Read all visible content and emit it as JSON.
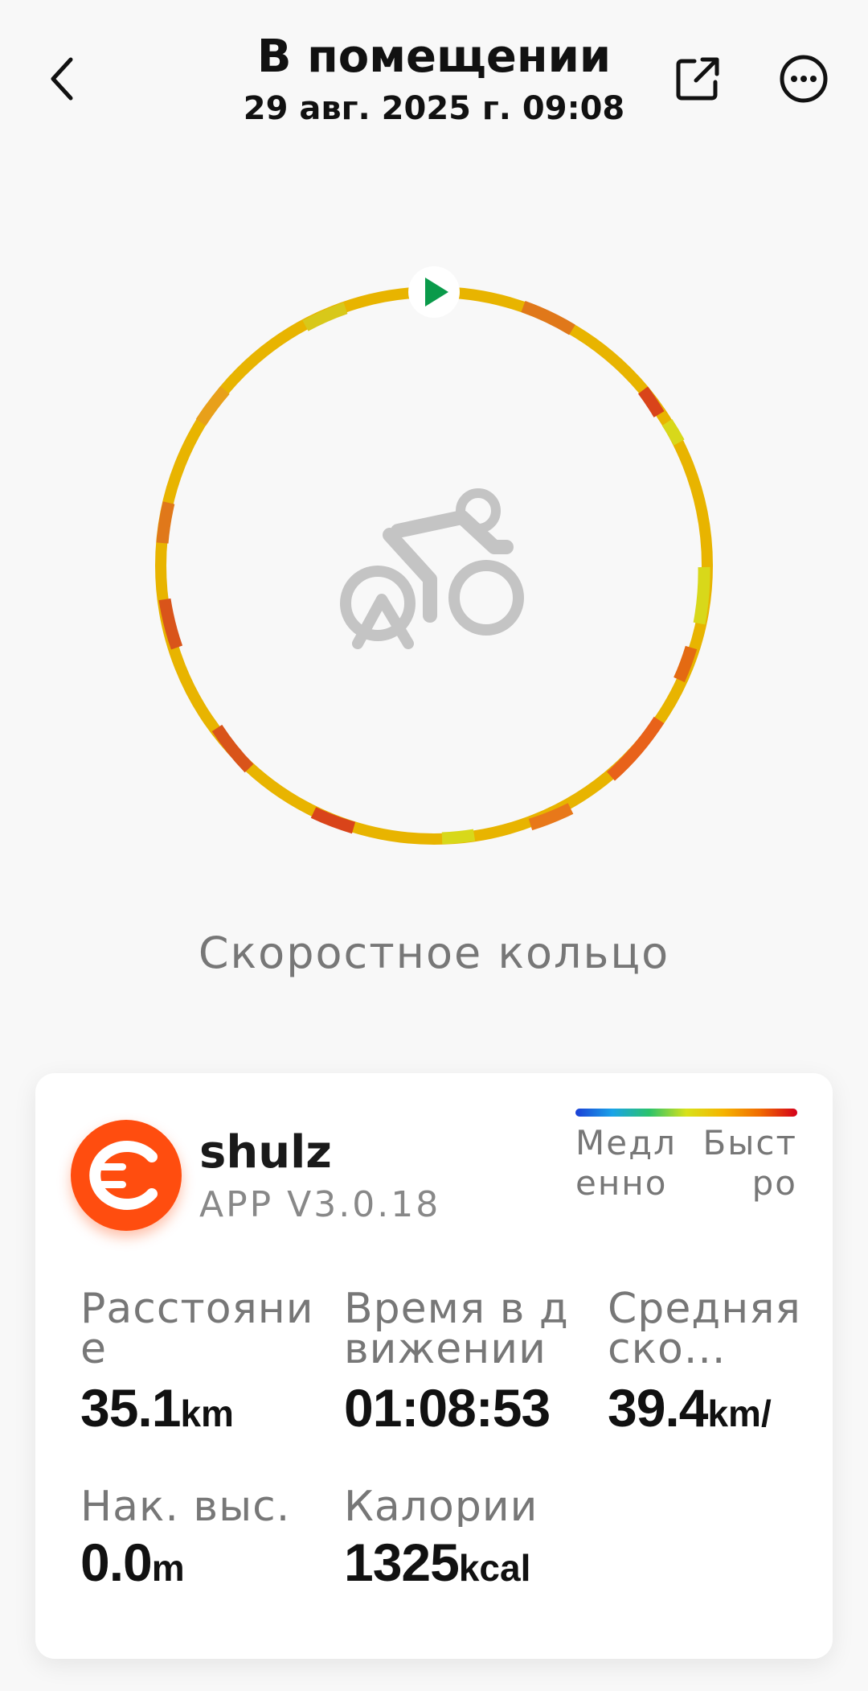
{
  "header": {
    "title": "В помещении",
    "datetime": "29 авг. 2025 г. 09:08",
    "back_icon": "chevron-left-icon",
    "share_icon": "share-external-icon",
    "more_icon": "more-dots-icon"
  },
  "ring": {
    "label": "Скоростное кольцо",
    "center_icon": "cyclist-icon",
    "start_icon": "play-icon",
    "base_color": "#e8b400",
    "start_color": "#0a9a4a"
  },
  "card": {
    "user_name": "shulz",
    "app_version": "APP V3.0.18",
    "app_logo_icon": "app-logo-icon",
    "brand_color": "#ff4d0f",
    "legend": {
      "slow": "Медленно",
      "fast": "Быстро"
    },
    "stats": [
      {
        "label": "Расстояние",
        "value": "35.1",
        "unit": "km"
      },
      {
        "label": "Время в движении",
        "value": "01:08:53",
        "unit": ""
      },
      {
        "label": "Средняя ско...",
        "value": "39.4",
        "unit": "km/"
      },
      {
        "label": "Нак. выс.",
        "value": "0.0",
        "unit": "m"
      },
      {
        "label": "Калории",
        "value": "1325",
        "unit": "kcal"
      }
    ]
  }
}
